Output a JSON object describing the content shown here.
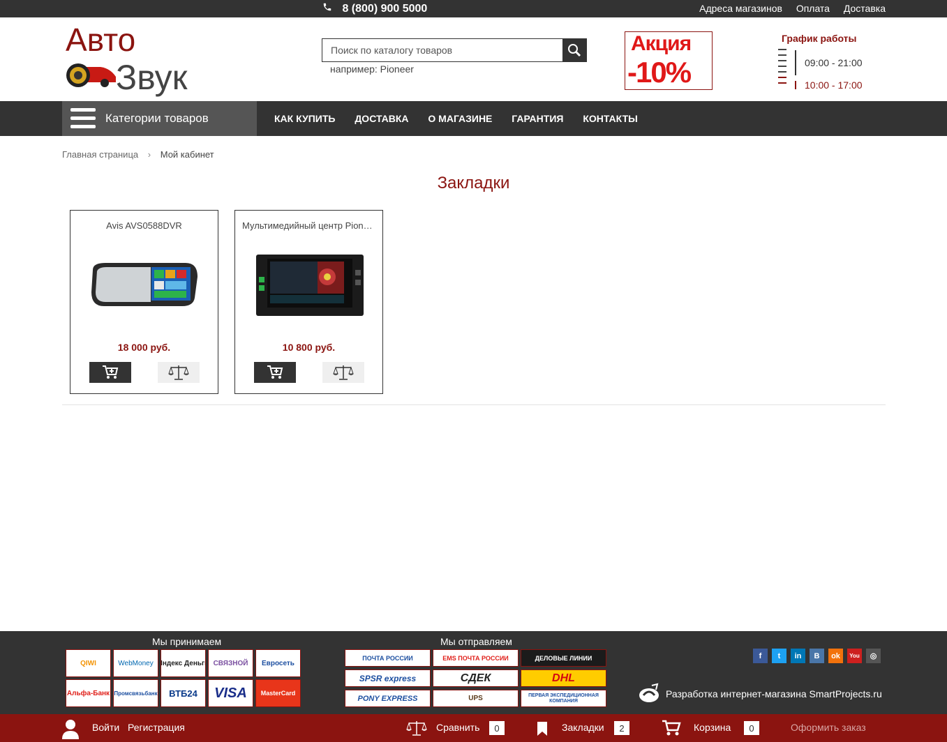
{
  "topbar": {
    "phone": "8 (800) 900 5000",
    "links": [
      "Адреса магазинов",
      "Оплата",
      "Доставка"
    ]
  },
  "logo": {
    "line1": "Авто",
    "line2": "Звук"
  },
  "search": {
    "placeholder": "Поиск по каталогу товаров",
    "hint": "например: Pioneer"
  },
  "promo": {
    "line1": "Акция",
    "line2": "-10%"
  },
  "hours": {
    "title": "График работы",
    "weekday": "09:00 - 21:00",
    "weekend": "10:00 - 17:00"
  },
  "nav": {
    "categories_label": "Категории товаров",
    "menu": [
      "КАК КУПИТЬ",
      "ДОСТАВКА",
      "О МАГАЗИНЕ",
      "ГАРАНТИЯ",
      "КОНТАКТЫ"
    ]
  },
  "breadcrumb": {
    "home": "Главная страница",
    "current": "Мой кабинет"
  },
  "page": {
    "title": "Закладки"
  },
  "products": [
    {
      "name": "Avis AVS0588DVR",
      "price": "18 000 руб.",
      "image": "rearview-mirror-dvr"
    },
    {
      "name": "Мультимедийный центр Pioneer",
      "price": "10 800 руб.",
      "image": "car-multimedia-head-unit"
    }
  ],
  "footer": {
    "payments_title": "Мы принимаем",
    "payments": [
      "QIWI",
      "WebMoney",
      "Яндекс Деньги",
      "СВЯЗНОЙ",
      "Евросеть",
      "Альфа-Банк",
      "Промсвязьбанк",
      "ВТБ24",
      "VISA",
      "MasterCard"
    ],
    "shipping_title": "Мы отправляем",
    "shipping": [
      "ПОЧТА РОССИИ",
      "EMS ПОЧТА РОССИИ",
      "ДЕЛОВЫЕ ЛИНИИ",
      "SPSR express",
      "СДЕК",
      "DHL",
      "PONY EXPRESS",
      "UPS",
      "ПЕРВАЯ ЭКСПЕДИЦИОННАЯ КОМПАНИЯ"
    ],
    "social": [
      "facebook",
      "twitter",
      "linkedin",
      "vk",
      "odnoklassniki",
      "youtube",
      "instagram"
    ],
    "developer": "Разработка интернет-магазина SmartProjects.ru"
  },
  "bottombar": {
    "login": "Войти",
    "register": "Регистрация",
    "compare_label": "Сравнить",
    "compare_count": "0",
    "bookmarks_label": "Закладки",
    "bookmarks_count": "2",
    "cart_label": "Корзина",
    "cart_count": "0",
    "checkout": "Оформить заказ"
  },
  "colors": {
    "brand_red": "#8b1410",
    "dark": "#333333",
    "accent_red": "#e01818"
  }
}
